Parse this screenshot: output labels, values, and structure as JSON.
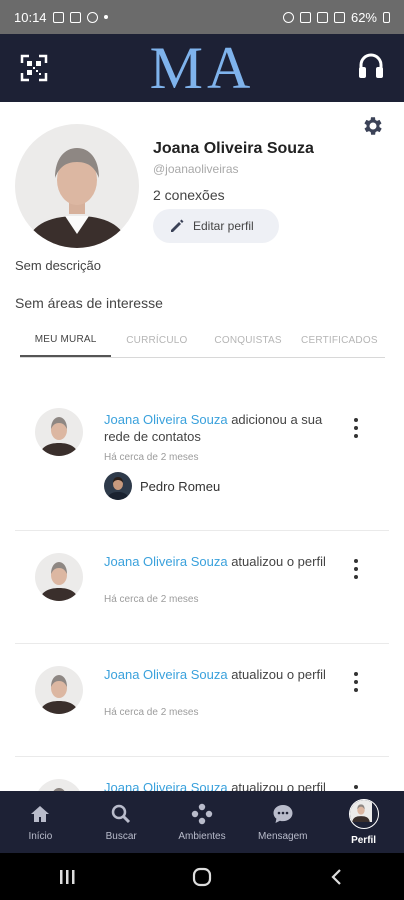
{
  "status_bar": {
    "time": "10:14",
    "battery": "62%"
  },
  "app_bar": {
    "logo": "MA"
  },
  "profile": {
    "name": "Joana Oliveira Souza",
    "username": "@joanaoliveiras",
    "connections": "2 conexões",
    "edit_label": "Editar perfil",
    "description": "Sem descrição",
    "interests": "Sem áreas de interesse"
  },
  "tabs": [
    {
      "label": "MEU MURAL"
    },
    {
      "label": "CURRÍCULO"
    },
    {
      "label": "CONQUISTAS"
    },
    {
      "label": "CERTIFICADOS"
    }
  ],
  "feed": [
    {
      "author": "Joana Oliveira Souza",
      "action": " adicionou a sua rede de contatos",
      "time": "Há cerca de 2 meses",
      "contact": "Pedro Romeu"
    },
    {
      "author": "Joana Oliveira Souza",
      "action": " atualizou o perfil",
      "time": "Há cerca de 2 meses"
    },
    {
      "author": "Joana Oliveira Souza",
      "action": " atualizou o perfil",
      "time": "Há cerca de 2 meses"
    },
    {
      "author": "Joana Oliveira Souza",
      "action": " atualizou o perfil"
    }
  ],
  "bottom_nav": [
    {
      "label": "Início",
      "icon": "home-icon"
    },
    {
      "label": "Buscar",
      "icon": "search-icon"
    },
    {
      "label": "Ambientes",
      "icon": "environments-icon"
    },
    {
      "label": "Mensagem",
      "icon": "chat-icon"
    },
    {
      "label": "Perfil",
      "icon": "avatar"
    }
  ],
  "colors": {
    "appbar": "#1d2135",
    "logo": "#7fb3ec",
    "link": "#3aa1dc"
  }
}
